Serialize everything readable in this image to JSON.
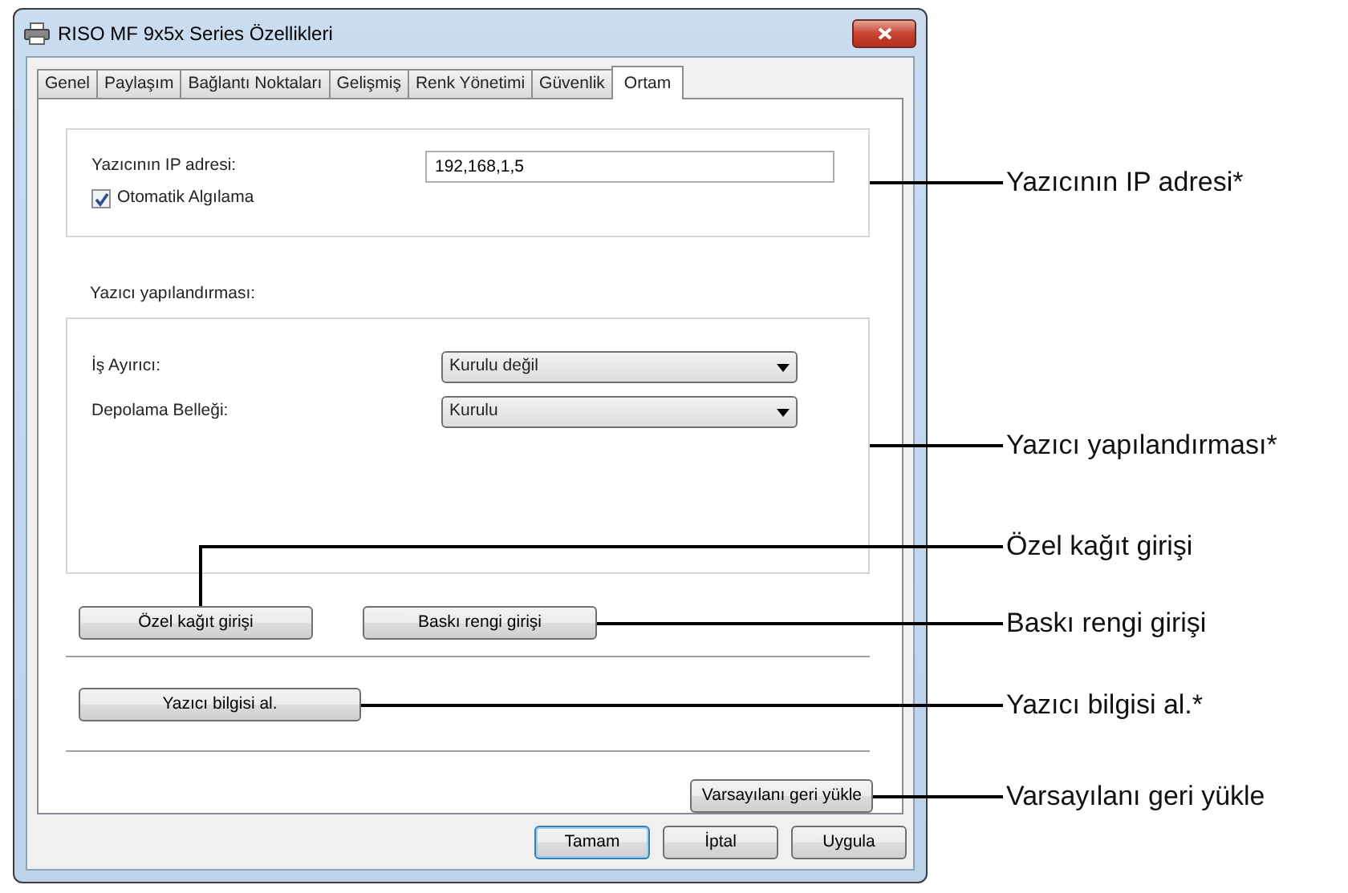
{
  "window": {
    "title": "RISO MF 9x5x Series Özellikleri"
  },
  "tabs": [
    {
      "label": "Genel",
      "selected": false
    },
    {
      "label": "Paylaşım",
      "selected": false
    },
    {
      "label": "Bağlantı Noktaları",
      "selected": false
    },
    {
      "label": "Gelişmiş",
      "selected": false
    },
    {
      "label": "Renk Yönetimi",
      "selected": false
    },
    {
      "label": "Güvenlik",
      "selected": false
    },
    {
      "label": "Ortam",
      "selected": true
    }
  ],
  "ip_group": {
    "label": "Yazıcının IP adresi:",
    "value": "192,168,1,5",
    "auto_detect": {
      "label": "Otomatik Algılama",
      "checked": true
    },
    "callout": {
      "text": "Yazıcının IP adresi*",
      "kind": "straight"
    }
  },
  "config": {
    "heading": "Yazıcı yapılandırması:",
    "fields": [
      {
        "label": "İş Ayırıcı:",
        "value": "Kurulu değil"
      },
      {
        "label": "Depolama Belleği:",
        "value": "Kurulu"
      }
    ],
    "callout": {
      "text": "Yazıcı yapılandırması*",
      "kind": "straight"
    }
  },
  "entry_buttons": [
    {
      "label": "Özel kağıt girişi",
      "callout": {
        "text": "Özel kağıt girişi",
        "kind": "elbow"
      }
    },
    {
      "label": "Baskı rengi girişi",
      "callout": {
        "text": "Baskı rengi girişi",
        "kind": "straight"
      }
    }
  ],
  "info_button": {
    "label": "Yazıcı bilgisi al.",
    "callout": {
      "text": "Yazıcı bilgisi al.*",
      "kind": "straight"
    }
  },
  "restore_button": {
    "label": "Varsayılanı geri yükle",
    "callout": {
      "text": "Varsayılanı geri yükle",
      "kind": "straight"
    }
  },
  "dialog_buttons": [
    {
      "label": "Tamam",
      "default": true
    },
    {
      "label": "İptal",
      "default": false
    },
    {
      "label": "Uygula",
      "default": false
    }
  ]
}
